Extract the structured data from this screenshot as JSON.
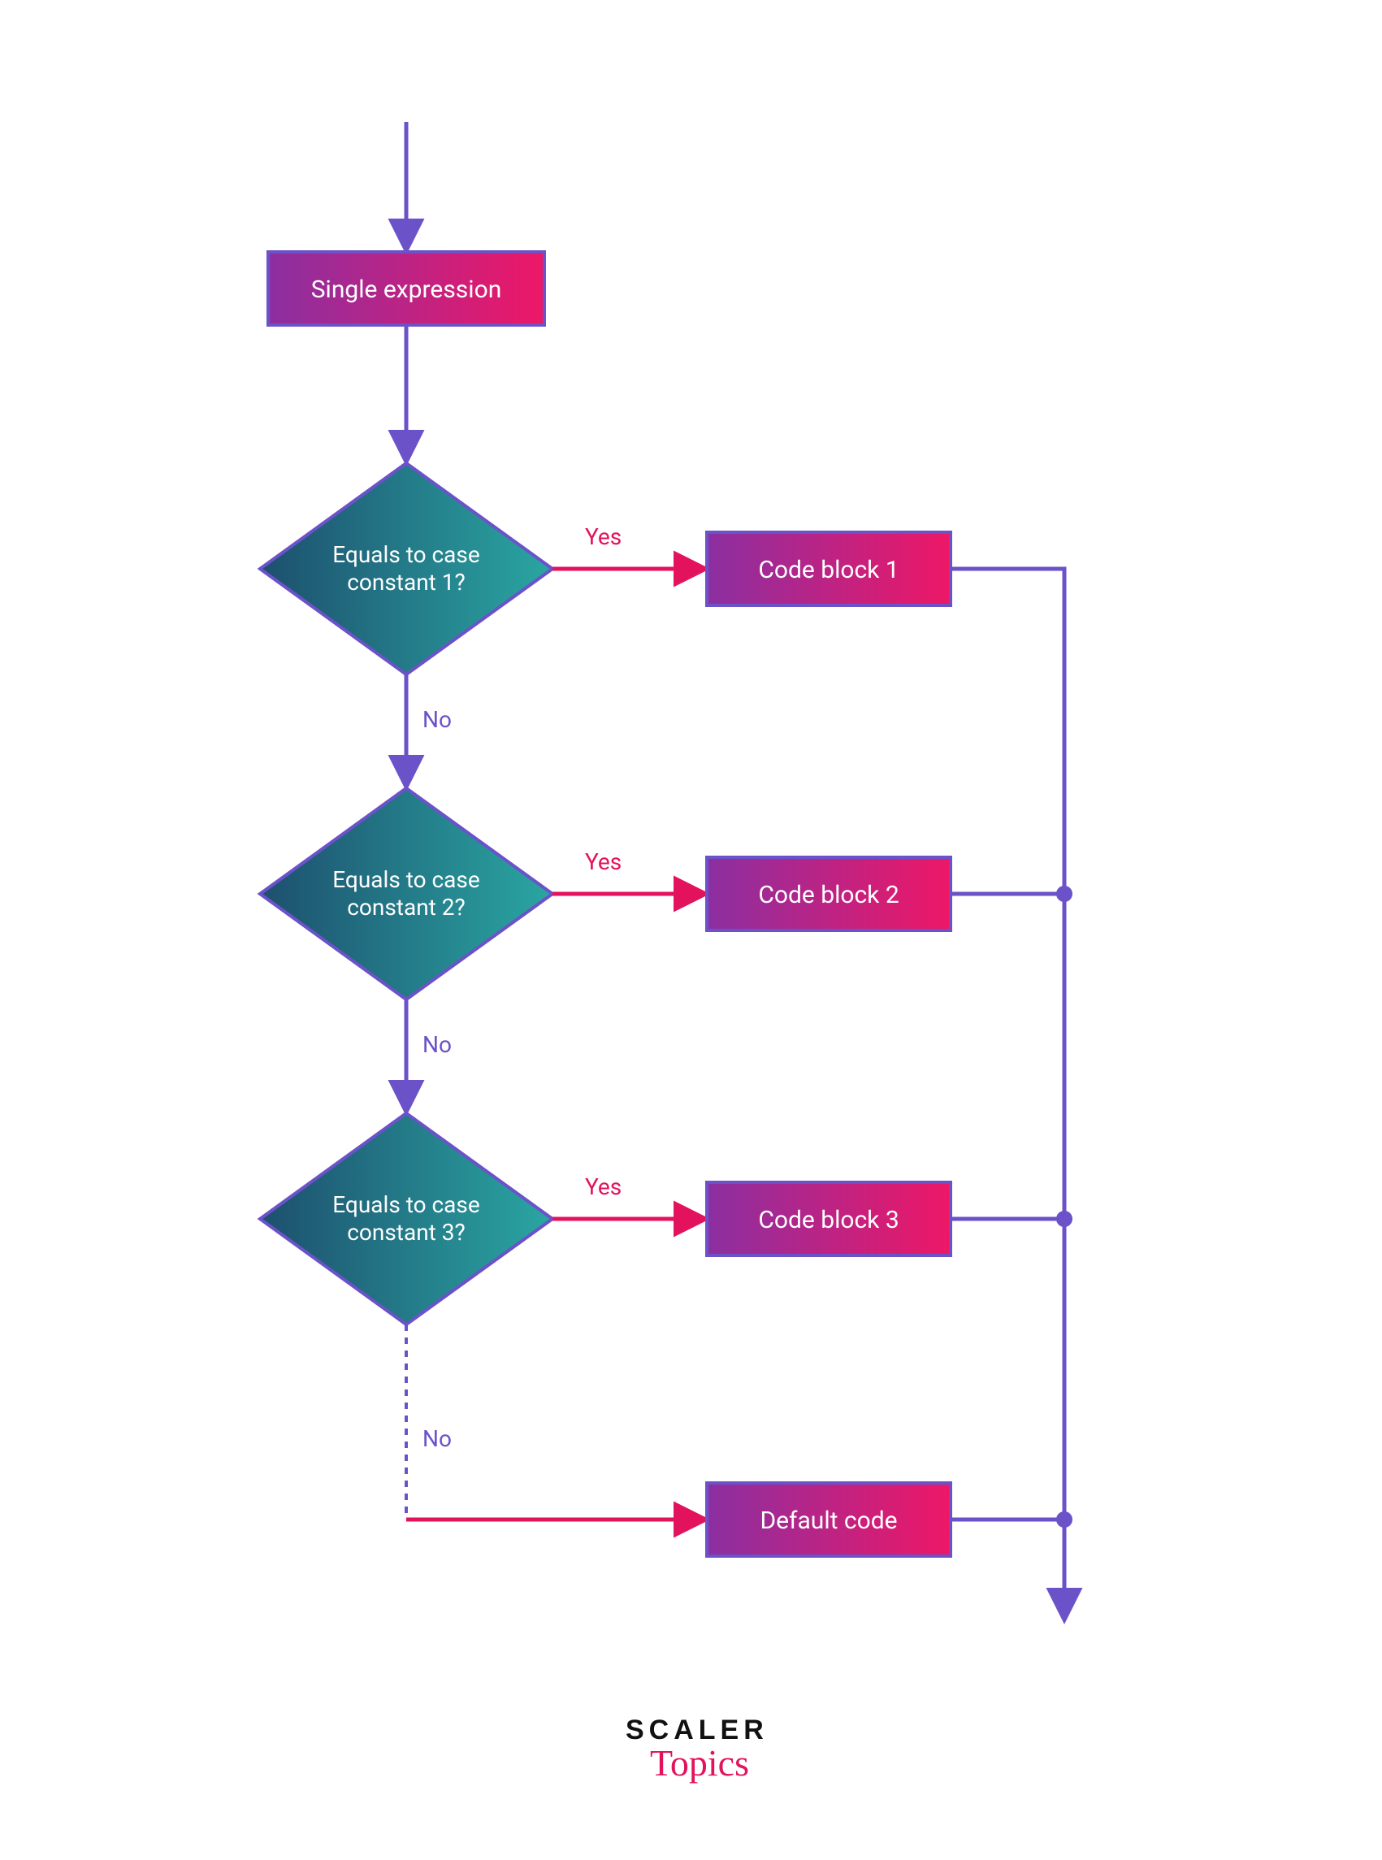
{
  "start": {
    "label": "Single expression"
  },
  "decisions": [
    {
      "line1": "Equals to case",
      "line2": "constant 1?",
      "yes": "Yes",
      "no": "No",
      "action": "Code block 1"
    },
    {
      "line1": "Equals to case",
      "line2": "constant 2?",
      "yes": "Yes",
      "no": "No",
      "action": "Code block 2"
    },
    {
      "line1": "Equals to case",
      "line2": "constant 3?",
      "yes": "Yes",
      "no": "No",
      "action": "Code block 3"
    }
  ],
  "default_no": "No",
  "default_action": "Default code",
  "logo": {
    "line1": "SCALER",
    "line2": "Topics"
  }
}
